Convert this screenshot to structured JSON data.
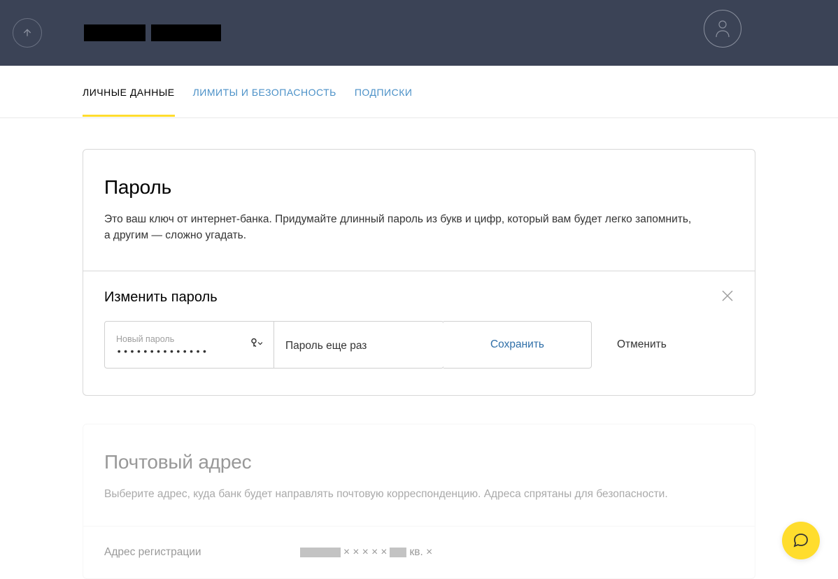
{
  "tabs": {
    "personal": "ЛИЧНЫЕ ДАННЫЕ",
    "security": "ЛИМИТЫ И БЕЗОПАСНОСТЬ",
    "subscriptions": "ПОДПИСКИ"
  },
  "password_card": {
    "title": "Пароль",
    "description": "Это ваш ключ от интернет-банка. Придумайте длинный пароль из букв и цифр, который вам будет легко запомнить, а другим — сложно угадать.",
    "change_title": "Изменить пароль",
    "new_password_label": "Новый пароль",
    "new_password_value": "••••••••••••••",
    "repeat_placeholder": "Пароль еще раз",
    "save_label": "Сохранить",
    "cancel_label": "Отменить"
  },
  "address_card": {
    "title": "Почтовый адрес",
    "description": "Выберите адрес, куда банк будет направлять почтовую корреспонденцию. Адреса спрятаны для безопасности.",
    "registration_label": "Адрес регистрации",
    "masked_middle": "× × × × ×",
    "masked_suffix": "кв. ×"
  }
}
